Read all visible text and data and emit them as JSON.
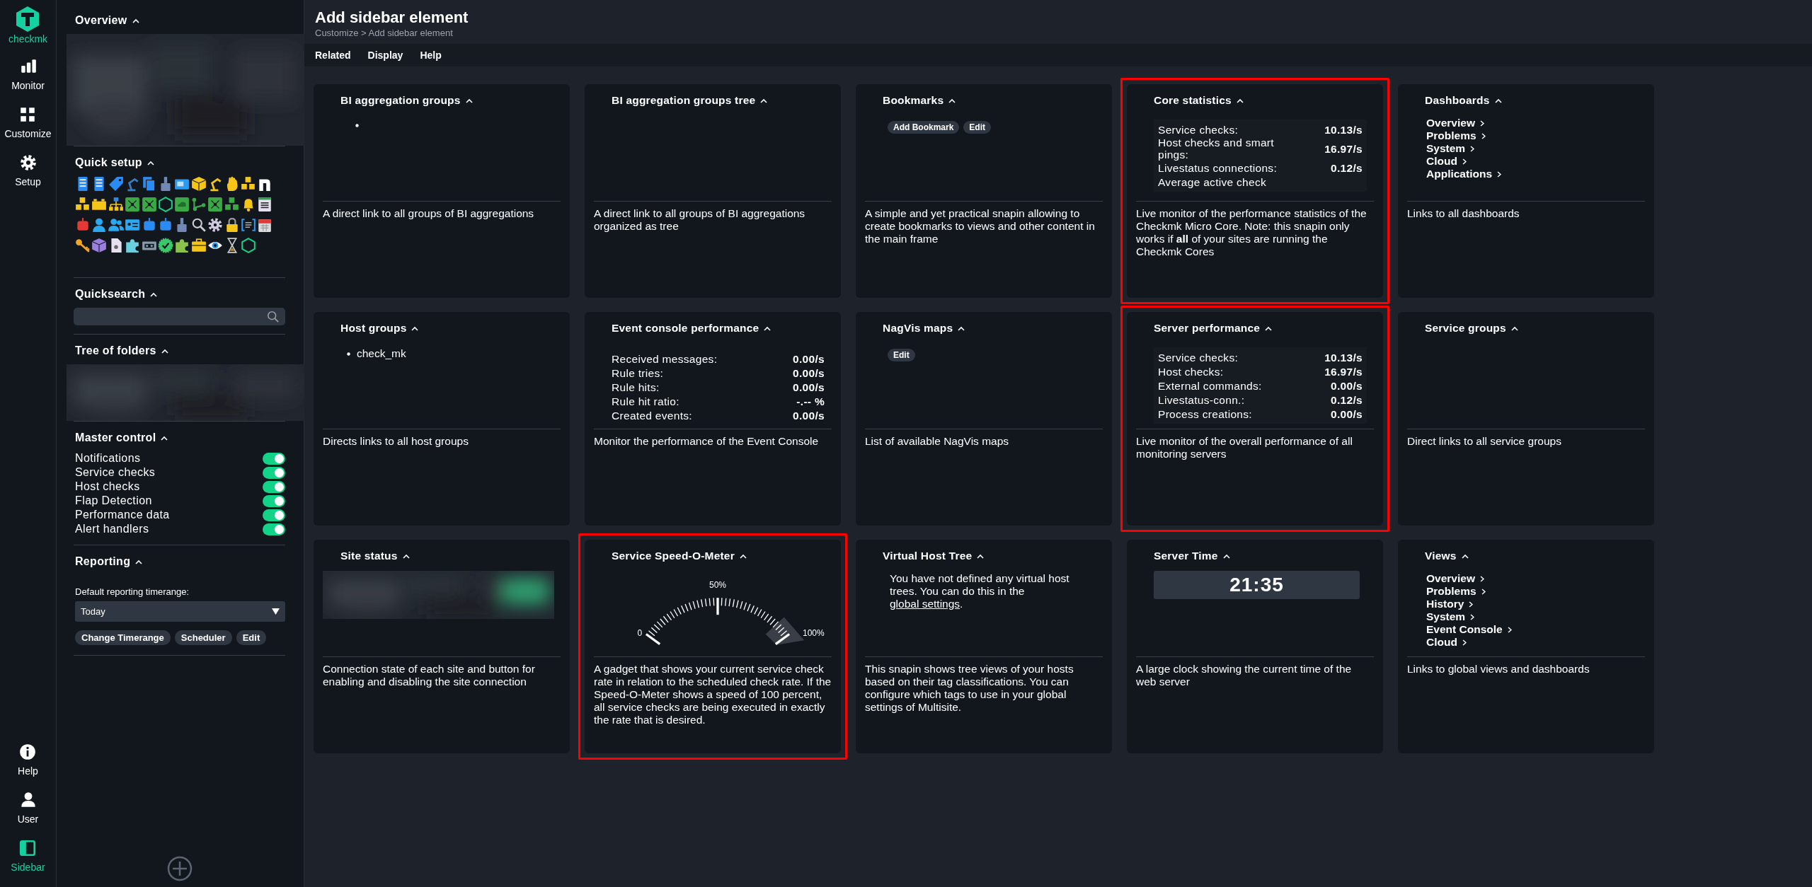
{
  "nav": {
    "logo": "checkmk",
    "items": [
      {
        "label": "Monitor",
        "kind": "monitor",
        "selected": false
      },
      {
        "label": "Customize",
        "kind": "customize",
        "selected": false
      },
      {
        "label": "Setup",
        "kind": "setup",
        "selected": false
      }
    ],
    "bottom": [
      {
        "label": "Help",
        "kind": "help",
        "selected": false
      },
      {
        "label": "User",
        "kind": "user",
        "selected": false
      },
      {
        "label": "Sidebar",
        "kind": "sidebar",
        "selected": true
      }
    ]
  },
  "sidebar": {
    "snapins": [
      {
        "kind": "picture",
        "title": "Overview"
      },
      {
        "kind": "quick_setup",
        "title": "Quick setup"
      },
      {
        "kind": "search",
        "title": "Quicksearch"
      },
      {
        "kind": "picture",
        "title": "Tree of folders"
      },
      {
        "kind": "master",
        "title": "Master control",
        "items": [
          {
            "label": "Notifications",
            "on": true
          },
          {
            "label": "Service checks",
            "on": true
          },
          {
            "label": "Host checks",
            "on": true
          },
          {
            "label": "Flap Detection",
            "on": true
          },
          {
            "label": "Performance data",
            "on": true
          },
          {
            "label": "Alert handlers",
            "on": true
          }
        ]
      },
      {
        "kind": "reporting",
        "title": "Reporting",
        "label": "Default reporting timerange:",
        "select": "Today",
        "buttons": [
          "Change Timerange",
          "Scheduler",
          "Edit"
        ]
      }
    ]
  },
  "page": {
    "title": "Add sidebar element",
    "breadcrumb": "Customize > Add sidebar element",
    "menu": [
      "Related",
      "Display",
      "Help"
    ]
  },
  "cards": [
    {
      "title": "BI aggregation groups",
      "highlighted": false,
      "preview": {
        "kind": "bullet"
      },
      "description": "A direct link to all groups of BI aggregations"
    },
    {
      "title": "BI aggregation groups tree",
      "highlighted": false,
      "preview": {
        "kind": "none"
      },
      "description": "A direct link to all groups of BI aggregations organized as tree"
    },
    {
      "title": "Bookmarks",
      "highlighted": false,
      "preview": {
        "kind": "buttons",
        "buttons": [
          "Add Bookmark",
          "Edit"
        ]
      },
      "description": "A simple and yet practical snapin allowing to create bookmarks to views and other content in the main frame"
    },
    {
      "title": "Core statistics",
      "highlighted": true,
      "preview": {
        "kind": "stats",
        "rows": [
          {
            "label": "Service checks:",
            "value": "10.13/s"
          },
          {
            "label": "Host checks and smart pings:",
            "value": "16.97/s"
          },
          {
            "label": "Livestatus connections:",
            "value": "0.12/s"
          },
          {
            "label": "Average active check"
          }
        ]
      },
      "description": "Live monitor of the performance statistics of the Checkmk Micro Core. Note: this snapin only works if **all** of your sites are running the Checkmk Cores"
    },
    {
      "title": "Dashboards",
      "highlighted": false,
      "preview": {
        "kind": "links",
        "items": [
          "Overview",
          "Problems",
          "System",
          "Cloud",
          "Applications"
        ]
      },
      "description": "Links to all dashboards"
    },
    {
      "title": "Host groups",
      "highlighted": false,
      "preview": {
        "kind": "list",
        "items": [
          "check_mk"
        ]
      },
      "description": "Directs links to all host groups"
    },
    {
      "title": "Event console performance",
      "highlighted": false,
      "preview": {
        "kind": "stats",
        "rows": [
          {
            "label": "Received messages:",
            "value": "0.00/s"
          },
          {
            "label": "Rule tries:",
            "value": "0.00/s"
          },
          {
            "label": "Rule hits:",
            "value": "0.00/s"
          },
          {
            "label": "Rule hit ratio:",
            "value": "-.-- %"
          },
          {
            "label": "Created events:",
            "value": "0.00/s"
          }
        ]
      },
      "description": "Monitor the performance of the Event Console"
    },
    {
      "title": "NagVis maps",
      "highlighted": false,
      "preview": {
        "kind": "buttons",
        "buttons": [
          "Edit"
        ]
      },
      "description": "List of available NagVis maps"
    },
    {
      "title": "Server performance",
      "highlighted": true,
      "preview": {
        "kind": "stats",
        "rows": [
          {
            "label": "Service checks:",
            "value": "10.13/s"
          },
          {
            "label": "Host checks:",
            "value": "16.97/s"
          },
          {
            "label": "External commands:",
            "value": "0.00/s"
          },
          {
            "label": "Livestatus-conn.:",
            "value": "0.12/s"
          },
          {
            "label": "Process creations:",
            "value": "0.00/s"
          }
        ]
      },
      "description": "Live monitor of the overall performance of all monitoring servers"
    },
    {
      "title": "Service groups",
      "highlighted": false,
      "preview": {
        "kind": "none"
      },
      "description": "Direct links to all service groups"
    },
    {
      "title": "Site status",
      "highlighted": false,
      "description": "Connection state of each site and button for enabling and disabling the site connection"
    },
    {
      "title": "Service Speed-O-Meter",
      "highlighted": true,
      "preview": {
        "kind": "gauge",
        "labels": [
          "0",
          "50%",
          "100%"
        ]
      },
      "description": "A gadget that shows your current service check rate in relation to the scheduled check rate. If the Speed-O-Meter shows a speed of 100 percent, all service checks are being executed in exactly the rate that is desired."
    },
    {
      "title": "Virtual Host Tree",
      "highlighted": false,
      "preview": {
        "kind": "text_link",
        "text": "You have not defined any virtual host trees. You can do this in the",
        "link": "global settings",
        "after": "."
      },
      "description": "This snapin shows tree views of your hosts based on their tag classifications. You can configure which tags to use in your global settings of Multisite."
    },
    {
      "title": "Server Time",
      "highlighted": false,
      "preview": {
        "kind": "clock",
        "time": "21:35"
      },
      "description": "A large clock showing the current time of the web server"
    },
    {
      "title": "Views",
      "highlighted": false,
      "preview": {
        "kind": "links",
        "items": [
          "Overview",
          "Problems",
          "History",
          "System",
          "Event Console",
          "Cloud"
        ]
      },
      "description": "Links to global views and dashboards"
    }
  ]
}
